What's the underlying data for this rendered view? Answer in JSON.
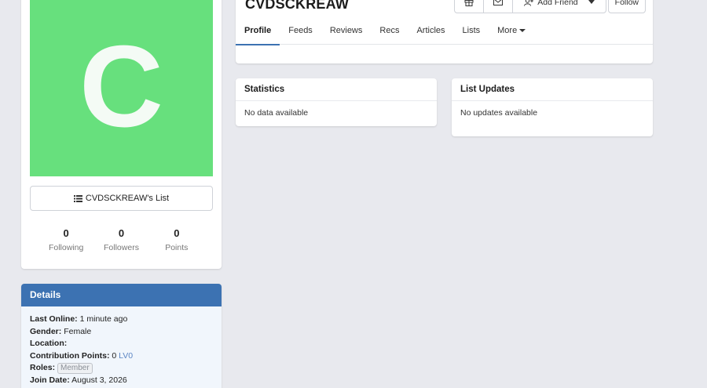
{
  "profile": {
    "avatar_letter": "C",
    "avatar_color": "#67e07d",
    "list_button_label": "CVDSCKREAW's List",
    "stats": [
      {
        "value": "0",
        "label": "Following"
      },
      {
        "value": "0",
        "label": "Followers"
      },
      {
        "value": "0",
        "label": "Points"
      }
    ]
  },
  "details": {
    "title": "Details",
    "last_online_label": "Last Online:",
    "last_online_value": "1 minute ago",
    "gender_label": "Gender:",
    "gender_value": "Female",
    "location_label": "Location:",
    "contribution_label": "Contribution Points:",
    "contribution_value": "0",
    "contribution_level": "LV0",
    "roles_label": "Roles:",
    "roles_value": "Member",
    "join_label": "Join Date:",
    "join_value": "August 3, 2026"
  },
  "header": {
    "username": "CVDSCKREAW",
    "add_friend_label": "Add Friend",
    "follow_label": "Follow",
    "tabs": [
      "Profile",
      "Feeds",
      "Reviews",
      "Recs",
      "Articles",
      "Lists",
      "More"
    ]
  },
  "statistics": {
    "title": "Statistics",
    "empty_text": "No data available"
  },
  "list_updates": {
    "title": "List Updates",
    "empty_text": "No updates available"
  },
  "colors": {
    "accent": "#3c72b2",
    "background": "#e8e9ee"
  }
}
